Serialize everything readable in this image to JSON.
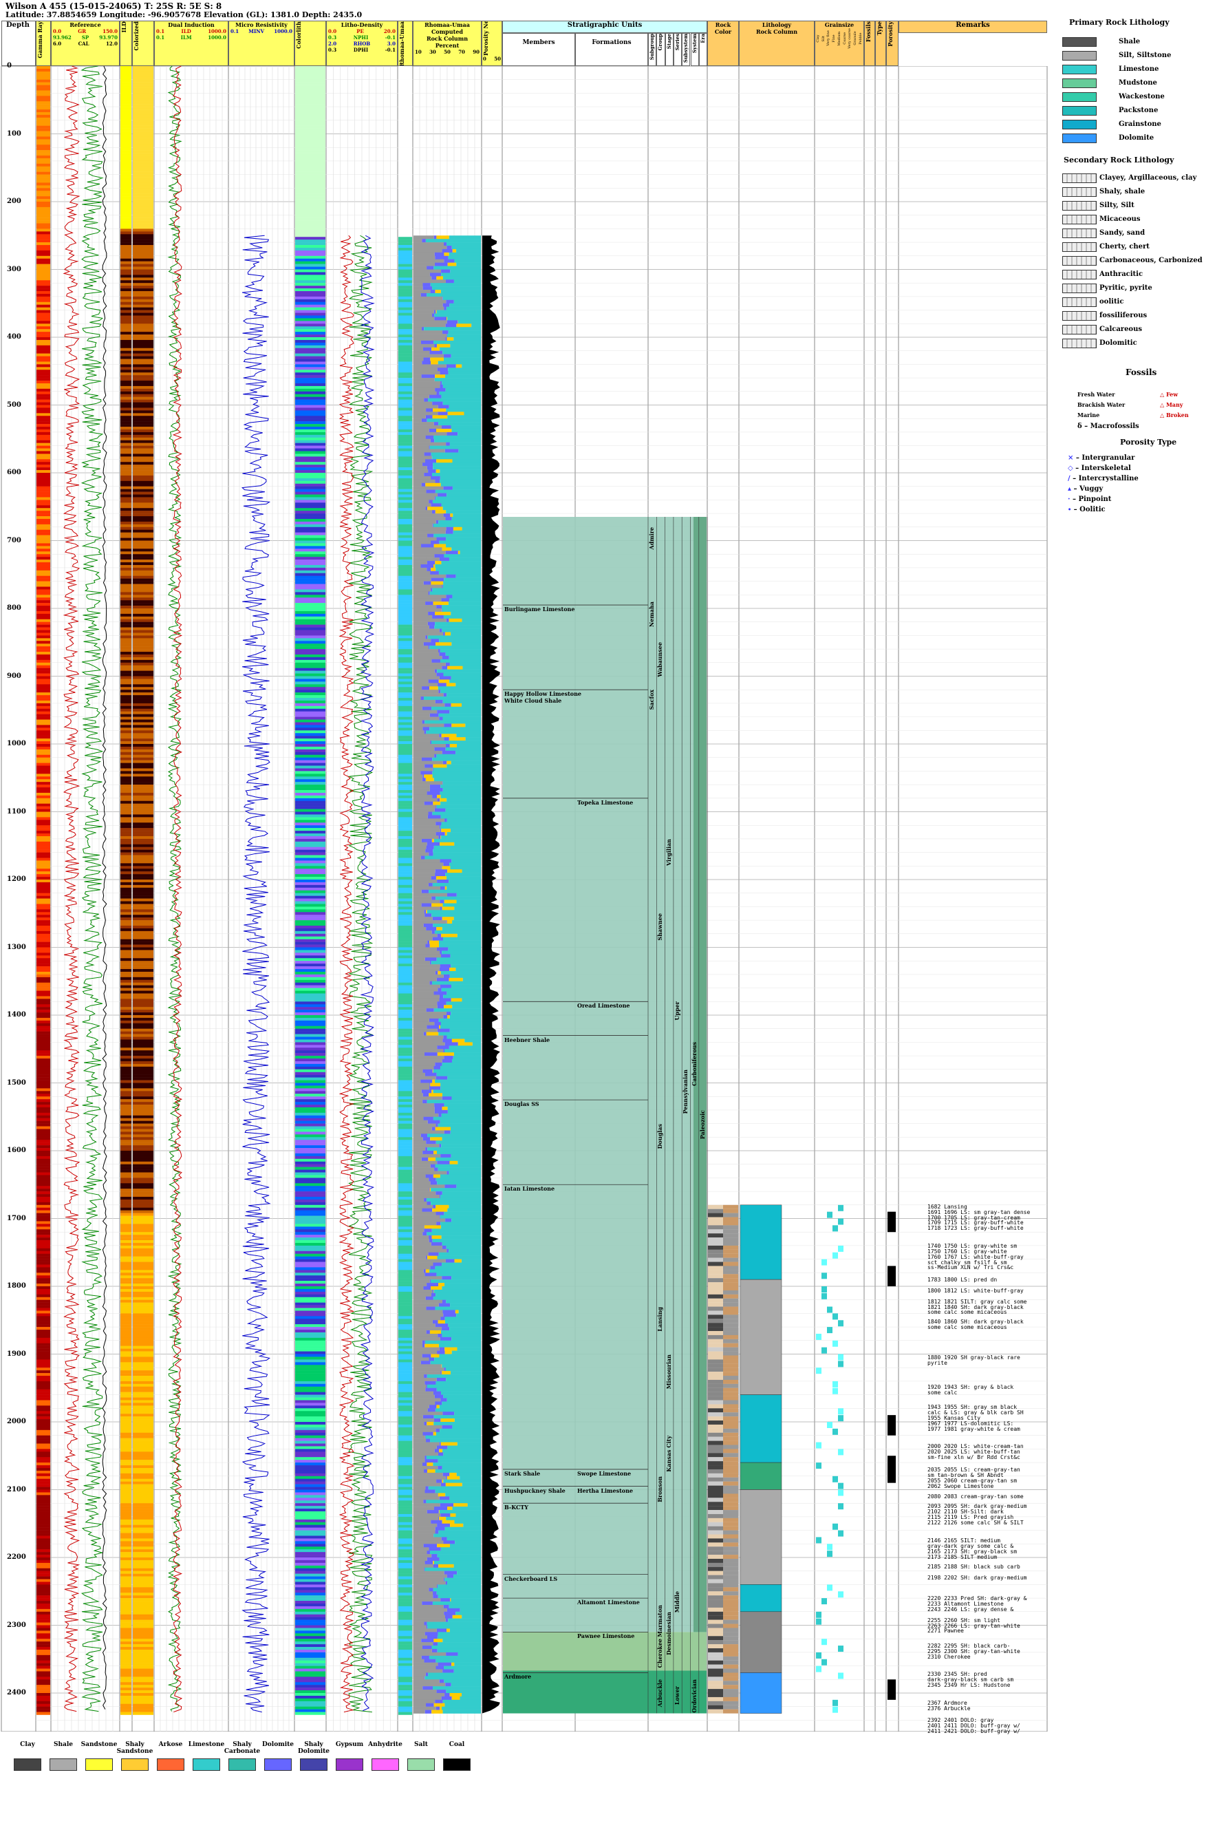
{
  "header": {
    "title": "Wilson A 455 (15-015-24065) T: 25S R: 5E S: 8",
    "subtitle": "Latitude: 37.8854659 Longitude: -96.9057678 Elevation (GL): 1381.0 Depth: 2435.0"
  },
  "tracks": {
    "depth": "Depth",
    "gamma": "Gamma Ray",
    "reference": "Reference",
    "ref_gr": "GR",
    "ref_gr_min": "0.0",
    "ref_gr_max": "150.0",
    "ref_sp": "SP",
    "ref_sp_min": "93.962",
    "ref_sp_max": "93.970",
    "ref_cal": "CAL",
    "ref_cal_min": "6.0",
    "ref_cal_max": "12.0",
    "color_a": "ILD",
    "color_b": "Colorized",
    "dual_induction": "Dual Induction",
    "ild": "ILD",
    "ild_min": "0.1",
    "ild_max": "1000.0",
    "ilm": "ILM",
    "ilm_min": "0.1",
    "ilm_max": "1000.0",
    "micro": "Micro Resistivity",
    "minv": "MINV",
    "minv_min": "0.1",
    "minv_max": "1000.0",
    "colorlith": "Colorlith",
    "litho_density": "Litho-Density",
    "pe": "PE",
    "pe_min": "0.0",
    "pe_max": "20.0",
    "nphi": "NPHI",
    "nphi_min": "0.3",
    "nphi_max": "-0.1",
    "rhob": "RHOB",
    "rhob_min": "2.0",
    "rhob_max": "3.0",
    "dphi": "DPHI",
    "dphi_min": "0.3",
    "dphi_max": "-0.1",
    "colorlith_b": "Colorlith Rhomaa-Umaa",
    "rhomaa": "Rhomaa-Umaa",
    "computed": "Computed",
    "rock_column": "Rock Column",
    "percent": "Percent",
    "pct_ticks": [
      "10",
      "30",
      "50",
      "70",
      "90"
    ],
    "porosity_neutron": "Porosity Neutron",
    "pn_ticks": [
      "0",
      "50"
    ],
    "strat": "Stratigraphic Units",
    "members": "Members",
    "formations": "Formations",
    "strat_cols": [
      "Subgroup",
      "Group",
      "Stage",
      "Series",
      "Subsystem",
      "System",
      "Era"
    ],
    "rock": "Rock",
    "rock_color": "Color",
    "lithology": "Lithology",
    "rock_col": "Rock Column",
    "grainsize": "Grainsize",
    "grain_cols": [
      "Clay",
      "Silt",
      "Very fine",
      "Fine",
      "Medium",
      "Coarse",
      "Very coarse",
      "Granule",
      "Pebble"
    ],
    "fossils": "Fossils",
    "type": "Type",
    "porosity": "Porosity",
    "remarks": "Remarks"
  },
  "depth_ticks": [
    "0",
    "100",
    "200",
    "300",
    "400",
    "500",
    "600",
    "700",
    "800",
    "900",
    "1000",
    "1100",
    "1200",
    "1300",
    "1400",
    "1500",
    "1600",
    "1700",
    "1800",
    "1900",
    "2000",
    "2100",
    "2200",
    "2300",
    "2400"
  ],
  "members": [
    {
      "name": "Burlingame Limestone",
      "depth": 795
    },
    {
      "name": "Happy Hollow Limestone",
      "depth": 920
    },
    {
      "name": "White Cloud Shale",
      "depth": 930
    },
    {
      "name": "Heebner Shale",
      "depth": 1430
    },
    {
      "name": "Douglas SS",
      "depth": 1525
    },
    {
      "name": "Iatan Limestone",
      "depth": 1650
    },
    {
      "name": "Stark Shale",
      "depth": 2070
    },
    {
      "name": "Hushpuckney Shale",
      "depth": 2095
    },
    {
      "name": "B-KCTY",
      "depth": 2120
    },
    {
      "name": "Checkerboard LS",
      "depth": 2225
    },
    {
      "name": "Ardmore",
      "depth": 2370
    }
  ],
  "formations": [
    {
      "name": "Topeka Limestone",
      "depth": 1080
    },
    {
      "name": "Oread Limestone",
      "depth": 1380
    },
    {
      "name": "Swope Limestone",
      "depth": 2070
    },
    {
      "name": "Hertha Limestone",
      "depth": 2095
    },
    {
      "name": "Altamont Limestone",
      "depth": 2260
    },
    {
      "name": "Pawnee Limestone",
      "depth": 2310
    }
  ],
  "groups": [
    {
      "name": "Admire",
      "depth": 680,
      "col": 0
    },
    {
      "name": "Wabaunsee",
      "depth": 850,
      "col": 1
    },
    {
      "name": "Nemaha",
      "depth": 790,
      "col": 0
    },
    {
      "name": "Shawnee",
      "depth": 1250,
      "col": 1
    },
    {
      "name": "Douglas",
      "depth": 1560,
      "col": 1
    },
    {
      "name": "Lansing",
      "depth": 1830,
      "col": 1
    },
    {
      "name": "Kansas City",
      "depth": 2020,
      "col": 2
    },
    {
      "name": "Marmaton",
      "depth": 2270,
      "col": 1
    },
    {
      "name": "Cherokee",
      "depth": 2320,
      "col": 1
    },
    {
      "name": "Arbuckle",
      "depth": 2380,
      "col": 1
    },
    {
      "name": "Bronson",
      "depth": 2080,
      "col": 1
    },
    {
      "name": "Sacfox",
      "depth": 920,
      "col": 0
    },
    {
      "name": "Virgilian",
      "depth": 1140,
      "col": 2
    },
    {
      "name": "Missourian",
      "depth": 1900,
      "col": 2
    },
    {
      "name": "Desmoinesian",
      "depth": 2280,
      "col": 2
    },
    {
      "name": "Middle",
      "depth": 2250,
      "col": 3
    },
    {
      "name": "Upper",
      "depth": 1380,
      "col": 3
    },
    {
      "name": "Pennsylvanian",
      "depth": 1480,
      "col": 4
    },
    {
      "name": "Carboniferous",
      "depth": 1440,
      "col": 5
    },
    {
      "name": "Paleozoic",
      "depth": 1540,
      "col": 6
    },
    {
      "name": "Lower",
      "depth": 2390,
      "col": 3
    },
    {
      "name": "Ordovician",
      "depth": 2380,
      "col": 5
    }
  ],
  "remarks": [
    {
      "d": 1682,
      "t": "1682 Lansing"
    },
    {
      "d": 1690,
      "t": "1691 1696 LS: sm gray-tan dense"
    },
    {
      "d": 1698,
      "t": "1700 1705 LS: gray-tan-cream"
    },
    {
      "d": 1706,
      "t": "1709 1715 LS: gray-buff-white"
    },
    {
      "d": 1714,
      "t": "1718 1723 LS: gray-buff-white"
    },
    {
      "d": 1740,
      "t": "1740 1750 LS: gray-white sm"
    },
    {
      "d": 1748,
      "t": "1750 1760 LS: gray-white"
    },
    {
      "d": 1756,
      "t": "1760 1767 LS: white-buff-gray"
    },
    {
      "d": 1764,
      "t": "sct chalky sm fsilf & sm"
    },
    {
      "d": 1772,
      "t": "ss-Medium XLN w/ Tri Crs&c"
    },
    {
      "d": 1790,
      "t": "1783 1800 LS: pred dn"
    },
    {
      "d": 1806,
      "t": "1800 1812 LS: white-buff-gray"
    },
    {
      "d": 1822,
      "t": "1812 1821 SILT: gray calc some"
    },
    {
      "d": 1830,
      "t": "1821 1840 SH: dark gray-black"
    },
    {
      "d": 1838,
      "t": "some calc some micaceous"
    },
    {
      "d": 1852,
      "t": "1840 1860 SH: dark gray-black"
    },
    {
      "d": 1860,
      "t": "some calc some micaceous"
    },
    {
      "d": 1905,
      "t": "1880 1920 SH gray-black rare"
    },
    {
      "d": 1913,
      "t": "pyrite"
    },
    {
      "d": 1948,
      "t": "1920 1943 SH: gray & black"
    },
    {
      "d": 1956,
      "t": "some calc"
    },
    {
      "d": 1978,
      "t": "1943 1955 SH: gray sm black"
    },
    {
      "d": 1986,
      "t": "calc & LS: gray & blk carb SH"
    },
    {
      "d": 1994,
      "t": "1955 Kansas City"
    },
    {
      "d": 2002,
      "t": "1967 1977 LS-dolomitic LS:"
    },
    {
      "d": 2010,
      "t": "1977 1981 gray-white & cream"
    },
    {
      "d": 2036,
      "t": "2000 2020 LS: white-cream-tan"
    },
    {
      "d": 2044,
      "t": "2020 2025 LS: white-buff-tan"
    },
    {
      "d": 2052,
      "t": "sm-fine xln w/ Br Rdd Crst&c"
    },
    {
      "d": 2070,
      "t": "2035 2055 LS: cream-gray-tan"
    },
    {
      "d": 2078,
      "t": "sm tan-brown & SH Abndt"
    },
    {
      "d": 2086,
      "t": "2055 2060 cream-gray-tan sm"
    },
    {
      "d": 2094,
      "t": "2062 Swope Limestone"
    },
    {
      "d": 2110,
      "t": "2080 2083 cream-gray-tan some"
    },
    {
      "d": 2124,
      "t": "2093 2095 SH: dark gray-medium"
    },
    {
      "d": 2132,
      "t": "2102 2110 SH-Silt: dark"
    },
    {
      "d": 2140,
      "t": "2115 2119 LS: Pred grayish"
    },
    {
      "d": 2148,
      "t": "2122 2126 some calc SH & SILT"
    },
    {
      "d": 2175,
      "t": "2146 2165 SILT: medium"
    },
    {
      "d": 2183,
      "t": "gray-dark gray some calc &"
    },
    {
      "d": 2191,
      "t": "2165 2173 SH: gray-black sm"
    },
    {
      "d": 2199,
      "t": "2173 2185 SILT medium"
    },
    {
      "d": 2213,
      "t": "2185 2188 SH: black sub carb"
    },
    {
      "d": 2229,
      "t": "2198 2202 SH: dark gray-medium"
    },
    {
      "d": 2260,
      "t": "2220 2233 Pred SH: dark-gray &"
    },
    {
      "d": 2268,
      "t": "2233 Altamont Limestone"
    },
    {
      "d": 2276,
      "t": "2243 2246 LS: gray dense &"
    },
    {
      "d": 2292,
      "t": "2255 2260 SH: sm light"
    },
    {
      "d": 2300,
      "t": "2263 2266 LS: gray-tan-white"
    },
    {
      "d": 2308,
      "t": "2271 Pawnee"
    },
    {
      "d": 2330,
      "t": "2282 2295 SH: black carb-"
    },
    {
      "d": 2338,
      "t": "2295 2300 SH: gray-tan-white"
    },
    {
      "d": 2346,
      "t": "2310 Cherokee"
    },
    {
      "d": 2372,
      "t": "2330 2345 SH: pred"
    },
    {
      "d": 2380,
      "t": "dark-gray-black sm carb sm"
    },
    {
      "d": 2388,
      "t": "2345 2349 Hr LS: Hudstone"
    },
    {
      "d": 2414,
      "t": "2367 Ardmore"
    },
    {
      "d": 2422,
      "t": "2376 Arbuckle"
    },
    {
      "d": 2440,
      "t": "2392 2401 DOLO: gray"
    },
    {
      "d": 2448,
      "t": "2401 2411 DOLO: buff-gray w/"
    },
    {
      "d": 2456,
      "t": "2411 2421 DOLO: buff-gray w/"
    }
  ],
  "legend": {
    "primary_title": "Primary Rock Lithology",
    "primary": [
      {
        "label": "Shale",
        "color": "#555555"
      },
      {
        "label": "Silt, Siltstone",
        "color": "#aaaaaa"
      },
      {
        "label": "Limestone",
        "color": "#33cccc"
      },
      {
        "label": "Mudstone",
        "color": "#66cc99"
      },
      {
        "label": "Wackestone",
        "color": "#33ccaa"
      },
      {
        "label": "Packstone",
        "color": "#22bbbb"
      },
      {
        "label": "Grainstone",
        "color": "#11aacc"
      },
      {
        "label": "Dolomite",
        "color": "#3399ff"
      }
    ],
    "secondary_title": "Secondary Rock Lithology",
    "secondary": [
      "Clayey, Argillaceous, clay",
      "Shaly, shale",
      "Silty, Silt",
      "Micaceous",
      "Sandy, sand",
      "Cherty, chert",
      "Carbonaceous, Carbonized",
      "Anthracitic",
      "Pyritic, pyrite",
      "oolitic",
      "fossiliferous",
      "Calcareous",
      "Dolomitic"
    ],
    "fossils_title": "Fossils",
    "fossils": [
      "Fresh Water",
      "Brackish Water",
      "Marine"
    ],
    "fossil_counts": [
      "Few",
      "Many",
      "Broken"
    ],
    "macrofossils": "Macrofossils",
    "porosity_title": "Porosity Type",
    "porosity": [
      "Intergranular",
      "Interskeletal",
      "Intercrystalline",
      "Vuggy",
      "Pinpoint",
      "Oolitic"
    ]
  },
  "bottom_legend": [
    {
      "label": "Clay",
      "color": "#444444"
    },
    {
      "label": "Shale",
      "color": "#aaaaaa"
    },
    {
      "label": "Sandstone",
      "color": "#ffff33"
    },
    {
      "label": "Shaly Sandstone",
      "color": "#ffcc33"
    },
    {
      "label": "Arkose",
      "color": "#ff6633"
    },
    {
      "label": "Limestone",
      "color": "#33cccc"
    },
    {
      "label": "Shaly Carbonate",
      "color": "#33bbaa"
    },
    {
      "label": "Dolomite",
      "color": "#6666ff"
    },
    {
      "label": "Shaly Dolomite",
      "color": "#4444aa"
    },
    {
      "label": "Gypsum",
      "color": "#9933cc"
    },
    {
      "label": "Anhydrite",
      "color": "#ff66ff"
    },
    {
      "label": "Salt",
      "color": "#99ddaa"
    },
    {
      "label": "Coal",
      "color": "#000000"
    }
  ]
}
